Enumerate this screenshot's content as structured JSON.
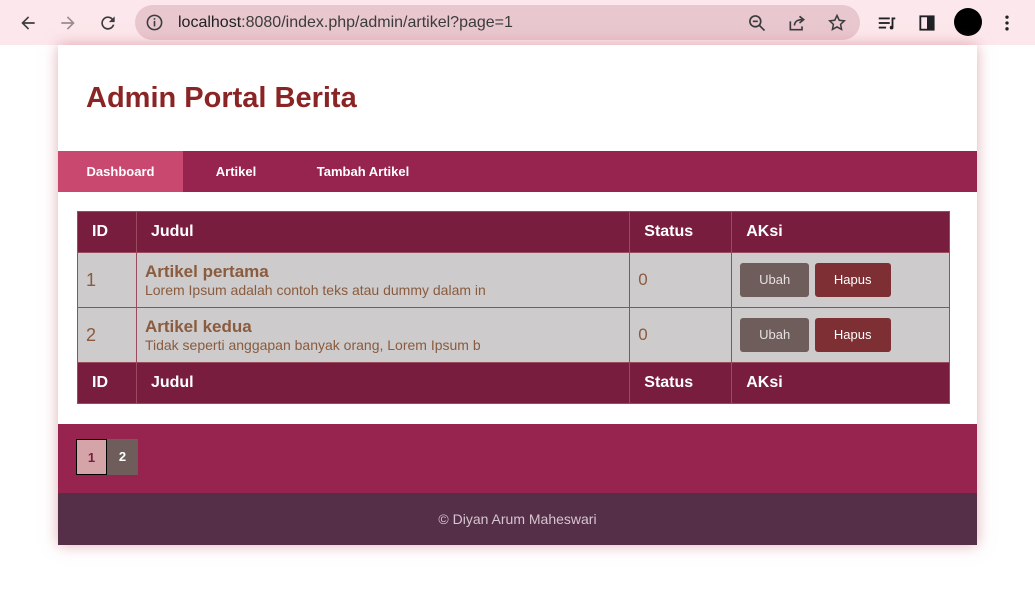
{
  "browser": {
    "url_host": "localhost",
    "url_rest": ":8080/index.php/admin/artikel?page=1"
  },
  "site": {
    "title": "Admin Portal Berita"
  },
  "menu": {
    "items": [
      {
        "label": "Dashboard",
        "active": true
      },
      {
        "label": "Artikel",
        "active": false
      },
      {
        "label": "Tambah Artikel",
        "active": false
      }
    ]
  },
  "table": {
    "headers": [
      "ID",
      "Judul",
      "Status",
      "AKsi"
    ],
    "rows": [
      {
        "id": "1",
        "title": "Artikel pertama",
        "excerpt": "Lorem Ipsum adalah contoh teks atau dummy dalam in",
        "status": "0",
        "edit_label": "Ubah",
        "delete_label": "Hapus"
      },
      {
        "id": "2",
        "title": "Artikel kedua",
        "excerpt": "Tidak seperti anggapan banyak orang, Lorem Ipsum b",
        "status": "0",
        "edit_label": "Ubah",
        "delete_label": "Hapus"
      }
    ],
    "footers": [
      "ID",
      "Judul",
      "Status",
      "AKsi"
    ]
  },
  "pagination": {
    "pages": [
      "1",
      "2"
    ],
    "current": "1"
  },
  "footer": {
    "text": "© Diyan Arum Maheswari"
  },
  "colors": {
    "title": "#8b2424",
    "menu_bg": "#97234f",
    "menu_active": "#c9486f",
    "table_head": "#791d3f",
    "footer_bg": "#552e48"
  }
}
